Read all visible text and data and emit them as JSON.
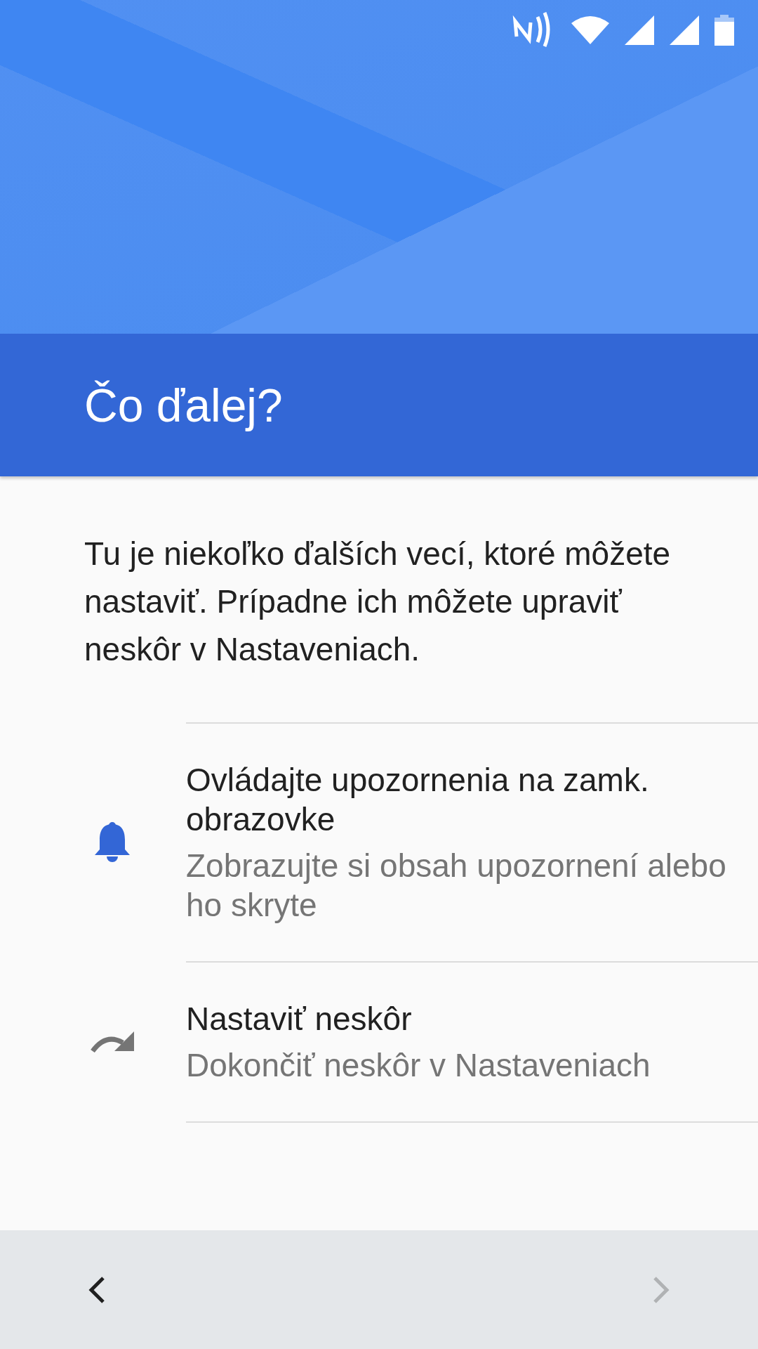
{
  "title": "Čo ďalej?",
  "intro": "Tu je niekoľko ďalších vecí, ktoré môžete nastaviť. Prípadne ich môžete upraviť neskôr v Nastaveniach.",
  "options": [
    {
      "kind": "notifications",
      "title": "Ovládajte upozornenia na zamk. obrazovke",
      "subtitle": "Zobrazujte si obsah upozornení alebo ho skryte"
    },
    {
      "kind": "skip",
      "title": "Nastaviť neskôr",
      "subtitle": "Dokončiť neskôr v Nastaveniach"
    }
  ],
  "navigation": {
    "back_disabled": false,
    "next_disabled": true
  }
}
